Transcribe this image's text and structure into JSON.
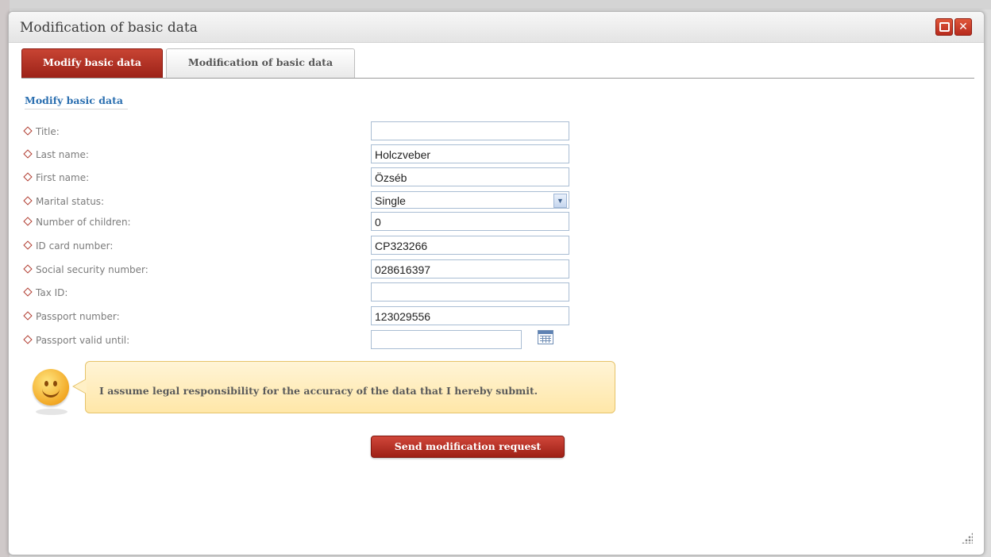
{
  "window": {
    "title": "Modification of basic data"
  },
  "tabs": [
    {
      "label": "Modify basic data",
      "active": true
    },
    {
      "label": "Modification of basic data",
      "active": false
    }
  ],
  "section_title": "Modify basic data",
  "form": {
    "fields": [
      {
        "label": "Title:",
        "value": ""
      },
      {
        "label": "Last name:",
        "value": "Holczveber"
      },
      {
        "label": "First name:",
        "value": "Özséb"
      },
      {
        "label": "Marital status:",
        "value": "Single"
      },
      {
        "label": "Number of children:",
        "value": "0"
      },
      {
        "label": "ID card number:",
        "value": "CP323266"
      },
      {
        "label": "Social security number:",
        "value": "028616397"
      },
      {
        "label": "Tax ID:",
        "value": ""
      },
      {
        "label": "Passport number:",
        "value": "123029556"
      },
      {
        "label": "Passport valid until:",
        "value": ""
      }
    ]
  },
  "notice": {
    "text": "I assume legal responsibility for the accuracy of the data that I hereby submit.",
    "icon": "smiley-icon"
  },
  "submit_label": "Send modification request",
  "colors": {
    "accent_red": "#b52a1e",
    "link_blue": "#2b6fb0",
    "notice_bg": "#ffe7a8"
  }
}
